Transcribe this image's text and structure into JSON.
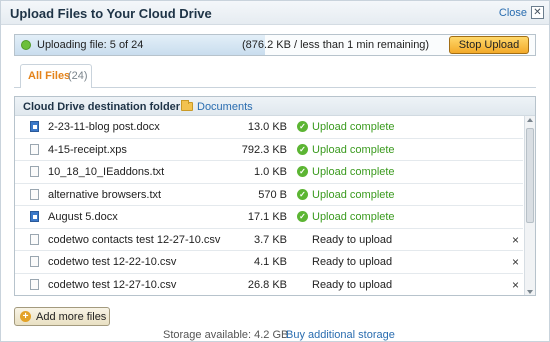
{
  "dialog": {
    "title": "Upload Files to Your Cloud Drive",
    "close_label": "Close",
    "close_icon": "✕"
  },
  "progress": {
    "status": "Uploading file: 5 of 24",
    "detail": "(876.2 KB / less than 1 min remaining)",
    "fraction": 0.48,
    "stop_label": "Stop Upload"
  },
  "tabs": [
    {
      "label": "All Files",
      "count": "(24)"
    }
  ],
  "destination": {
    "label": "Cloud Drive destination folder:",
    "folder": "Documents"
  },
  "files": [
    {
      "name": "2-23-11-blog post.docx",
      "size": "13.0 KB",
      "status": "Upload complete",
      "state": "complete",
      "icon": "word-doc-icon"
    },
    {
      "name": "4-15-receipt.xps",
      "size": "792.3 KB",
      "status": "Upload complete",
      "state": "complete",
      "icon": "file-icon"
    },
    {
      "name": "10_18_10_IEaddons.txt",
      "size": "1.0 KB",
      "status": "Upload complete",
      "state": "complete",
      "icon": "file-icon"
    },
    {
      "name": "alternative browsers.txt",
      "size": "570 B",
      "status": "Upload complete",
      "state": "complete",
      "icon": "file-icon"
    },
    {
      "name": "August 5.docx",
      "size": "17.1 KB",
      "status": "Upload complete",
      "state": "complete",
      "icon": "word-doc-icon"
    },
    {
      "name": "codetwo contacts test 12-27-10.csv",
      "size": "3.7 KB",
      "status": "Ready to upload",
      "state": "ready",
      "icon": "file-icon"
    },
    {
      "name": "codetwo test 12-22-10.csv",
      "size": "4.1 KB",
      "status": "Ready to upload",
      "state": "ready",
      "icon": "file-icon"
    },
    {
      "name": "codetwo test 12-27-10.csv",
      "size": "26.8 KB",
      "status": "Ready to upload",
      "state": "ready",
      "icon": "file-icon"
    }
  ],
  "remove_icon": "×",
  "footer": {
    "add_label": "Add more files",
    "add_icon": "+",
    "storage_text": "Storage available: 4.2 GB",
    "buy_link": "Buy additional storage"
  },
  "colors": {
    "complete": "#3a9a1e",
    "link": "#2a6db0",
    "tab_active": "#e4831a",
    "stop_button": "#f3aa2a"
  }
}
